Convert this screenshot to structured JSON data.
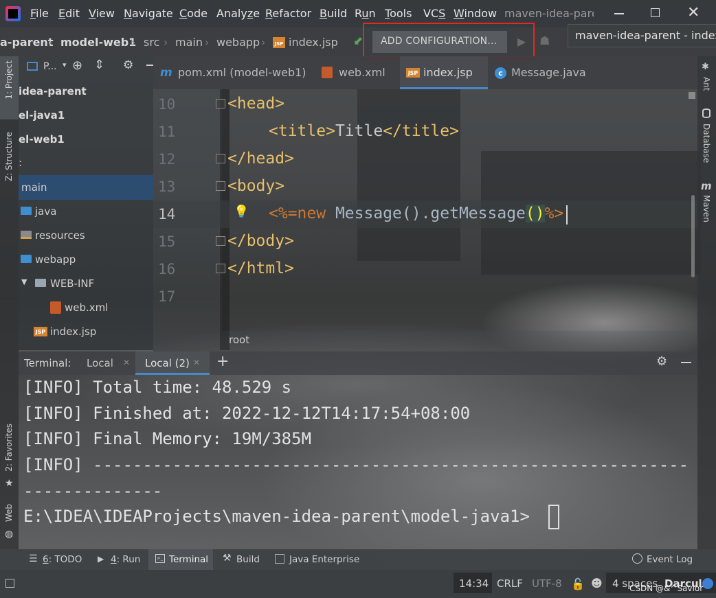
{
  "title_bar": {
    "menu": [
      {
        "label": "File",
        "u": "F"
      },
      {
        "label": "Edit",
        "u": "E"
      },
      {
        "label": "View",
        "u": "V"
      },
      {
        "label": "Navigate",
        "u": "N"
      },
      {
        "label": "Code",
        "u": "C"
      },
      {
        "label": "Analyze",
        "u": "z"
      },
      {
        "label": "Refactor",
        "u": "R"
      },
      {
        "label": "Build",
        "u": "B"
      },
      {
        "label": "Run",
        "u": "u"
      },
      {
        "label": "Tools",
        "u": "T"
      },
      {
        "label": "VCS",
        "u": "S"
      },
      {
        "label": "Window",
        "u": "W"
      }
    ],
    "project_title": "maven-idea-parer"
  },
  "nav_bar": {
    "crumbs": [
      "a-parent",
      "model-web1",
      "src",
      "main",
      "webapp",
      "index.jsp"
    ],
    "add_configuration": "ADD CONFIGURATION...",
    "tooltip": "maven-idea-parent - index.js"
  },
  "left_stripe": {
    "project": "1: Project",
    "structure": "Z: Structure",
    "favorites": "2: Favorites",
    "web": "Web"
  },
  "project_panel": {
    "header": "P...",
    "items": [
      {
        "label": "idea-parent",
        "bold": true
      },
      {
        "label": "el-java1",
        "bold": true
      },
      {
        "label": "el-web1",
        "bold": true
      },
      {
        "label": ":",
        "bold": false
      },
      {
        "label": "main",
        "bold": false
      },
      {
        "label": "java",
        "bold": false
      },
      {
        "label": "resources",
        "bold": false
      },
      {
        "label": "webapp",
        "bold": false
      },
      {
        "label": "WEB-INF",
        "bold": false
      },
      {
        "label": "web.xml",
        "bold": false
      },
      {
        "label": "index.jsp",
        "bold": false
      }
    ]
  },
  "editor_tabs": [
    "pom.xml (model-web1)",
    "web.xml",
    "index.jsp",
    "Message.java"
  ],
  "editor": {
    "line_numbers": [
      "10",
      "11",
      "12",
      "13",
      "14",
      "15",
      "16",
      "17"
    ],
    "lines": {
      "l10": "<head>",
      "l11_open": "<title>",
      "l11_text": "Title",
      "l11_close": "</title>",
      "l12": "</head>",
      "l13": "<body>",
      "l14_open": "<%=",
      "l14_new": "new",
      "l14_expr": " Message().getMessage",
      "l14_paren": "()",
      "l14_close": "%>",
      "l15": "</body>",
      "l16": "</html>"
    },
    "breadcrumb": "root"
  },
  "right_stripe": {
    "ant": "Ant",
    "database": "Database",
    "maven": "Maven"
  },
  "terminal": {
    "label": "Terminal:",
    "tabs": [
      "Local",
      "Local (2)"
    ],
    "lines": [
      "[INFO] Total time: 48.529 s",
      "[INFO] Finished at: 2022-12-12T14:17:54+08:00",
      "[INFO] Final Memory: 19M/385M",
      "[INFO] ------------------------------------------------------------",
      "--------------",
      "E:\\IDEA\\IDEAProjects\\maven-idea-parent\\model-java1>"
    ]
  },
  "tool_windows": [
    {
      "num": "6",
      "label": ": TODO"
    },
    {
      "num": "4",
      "label": ": Run"
    },
    {
      "num": "",
      "label": "Terminal"
    },
    {
      "num": "",
      "label": "Build"
    },
    {
      "num": "",
      "label": "Java Enterprise"
    }
  ],
  "event_log": "Event Log",
  "status_bar": {
    "position": "14:34",
    "line_sep": "CRLF",
    "encoding": "UTF-8",
    "indent": "4 spaces",
    "theme": "Darcula",
    "watermark": "CSDN @&^Savior"
  }
}
